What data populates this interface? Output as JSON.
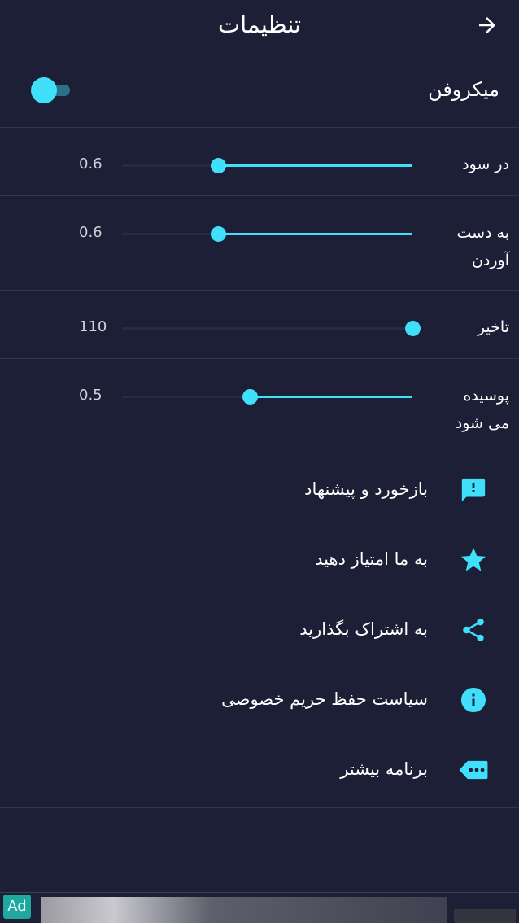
{
  "header": {
    "title": "تنظیمات",
    "back_icon": "arrow-back-icon"
  },
  "microphone": {
    "label": "میکروفن",
    "enabled": true
  },
  "sliders": [
    {
      "label": "در سود",
      "value_text": "0.6",
      "position_fraction": 0.67
    },
    {
      "label": "به دست آوردن",
      "value_text": "0.6",
      "position_fraction": 0.67
    },
    {
      "label": "تاخیر",
      "value_text": "110",
      "position_fraction": 0.0
    },
    {
      "label": "پوسیده می شود",
      "value_text": "0.5",
      "position_fraction": 0.56
    }
  ],
  "menu": [
    {
      "label": "بازخورد و پیشنهاد",
      "icon": "feedback-icon"
    },
    {
      "label": "به ما امتیاز دهید",
      "icon": "star-icon"
    },
    {
      "label": "به اشتراک بگذارید",
      "icon": "share-icon"
    },
    {
      "label": "سیاست حفظ حریم خصوصی",
      "icon": "info-icon"
    },
    {
      "label": "برنامه بیشتر",
      "icon": "more-apps-icon"
    }
  ],
  "ad": {
    "badge": "Ad"
  },
  "colors": {
    "background": "#1c1f35",
    "accent": "#40e0fb",
    "divider": "#33364d"
  }
}
